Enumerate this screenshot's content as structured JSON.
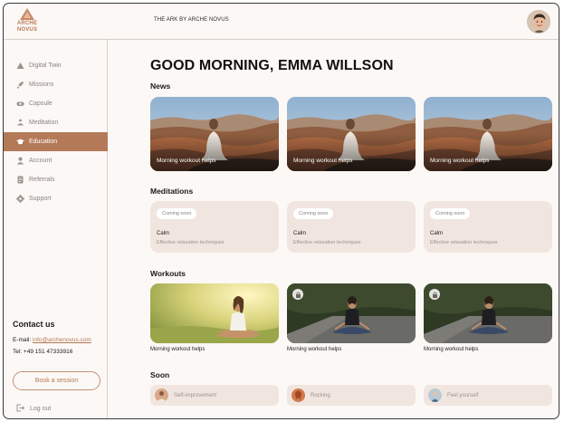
{
  "brand": {
    "logo_line1": "ARCHE",
    "logo_line2": "NOVUS",
    "accent": "#b47a58"
  },
  "header": {
    "title": "THE ARK BY ARCHE NOVUS"
  },
  "sidebar": {
    "items": [
      {
        "label": "Digital Twin",
        "icon": "triangle-icon",
        "active": false
      },
      {
        "label": "Missions",
        "icon": "rocket-icon",
        "active": false
      },
      {
        "label": "Capsule",
        "icon": "capsule-icon",
        "active": false
      },
      {
        "label": "Meditation",
        "icon": "meditation-icon",
        "active": false
      },
      {
        "label": "Education",
        "icon": "graduation-cap-icon",
        "active": true
      },
      {
        "label": "Account",
        "icon": "user-icon",
        "active": false
      },
      {
        "label": "Referrals",
        "icon": "document-icon",
        "active": false
      },
      {
        "label": "Support",
        "icon": "gear-icon",
        "active": false
      }
    ],
    "contact": {
      "title": "Contact us",
      "email_label": "E-mail:",
      "email": "info@archenovus.com",
      "phone": "Tel: +49 151 47333916"
    },
    "book_label": "Book a session",
    "logout_label": "Log out"
  },
  "main": {
    "greeting": "GOOD MORNING, EMMA WILLSON",
    "news": {
      "title": "News",
      "items": [
        {
          "caption": "Morning workout helps"
        },
        {
          "caption": "Morning workout helps"
        },
        {
          "caption": "Morning workout helps"
        }
      ]
    },
    "meditations": {
      "title": "Meditations",
      "items": [
        {
          "badge": "Coming soon",
          "title": "Calm",
          "desc": "Effective relaxation techniques"
        },
        {
          "badge": "Coming soon",
          "title": "Calm",
          "desc": "Effective relaxation techniques"
        },
        {
          "badge": "Coming soon",
          "title": "Calm",
          "desc": "Effective relaxation techniques"
        }
      ]
    },
    "workouts": {
      "title": "Workouts",
      "items": [
        {
          "caption": "Morning workout helps",
          "locked": false
        },
        {
          "caption": "Morning workout helps",
          "locked": true
        },
        {
          "caption": "Morning workout helps",
          "locked": true
        }
      ]
    },
    "soon": {
      "title": "Soon",
      "items": [
        {
          "label": "Self-improvement"
        },
        {
          "label": "Rocking"
        },
        {
          "label": "Feel yourself"
        }
      ]
    }
  }
}
